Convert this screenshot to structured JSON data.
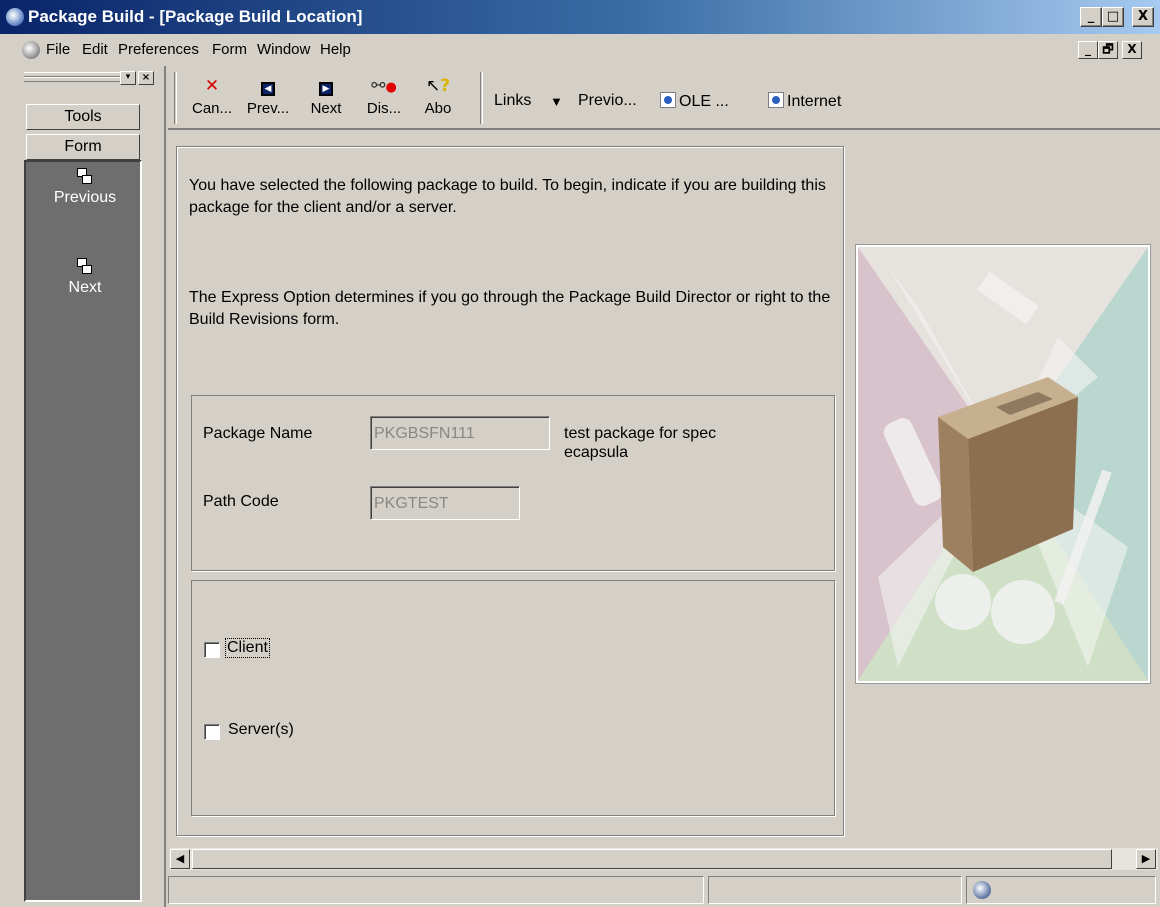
{
  "window": {
    "title": "Package Build - [Package Build Location]",
    "controls": [
      "_",
      "□",
      "X"
    ],
    "mdi_controls": [
      "_",
      "🗗",
      "X"
    ]
  },
  "menu": [
    "File",
    "Edit",
    "Preferences",
    "Form",
    "Window",
    "Help"
  ],
  "left_pane": {
    "tools_label": "Tools",
    "form_label": "Form",
    "items": [
      {
        "label": "Previous"
      },
      {
        "label": "Next"
      }
    ]
  },
  "toolbar": {
    "buttons": [
      {
        "label": "Can...",
        "icon": "cancel-icon"
      },
      {
        "label": "Prev...",
        "icon": "previous-icon"
      },
      {
        "label": "Next",
        "icon": "next-icon"
      },
      {
        "label": "Dis...",
        "icon": "display-icon"
      },
      {
        "label": "Abo",
        "icon": "about-icon"
      }
    ],
    "links_label": "Links",
    "previo_label": "Previo...",
    "ole_label": "OLE ...",
    "internet_label": "Internet"
  },
  "form": {
    "intro_text": "You have selected the following package to build.  To begin, indicate if you are building this package for the client and/or a server.",
    "express_text": "The Express Option determines if you go through the Package Build Director or right to the Build Revisions form.",
    "package_name_label": "Package Name",
    "package_name_value": "PKGBSFN111",
    "package_description": "test package for spec ecapsula",
    "path_code_label": "Path Code",
    "path_code_value": "PKGTEST",
    "client_label": "Client",
    "client_checked": false,
    "server_label": "Server(s)",
    "server_checked": false
  },
  "colors": {
    "titlebar_start": "#0a246a",
    "titlebar_end": "#a6caf0",
    "face": "#d4d0c8",
    "left_pane_dark": "#6e6e6e"
  }
}
